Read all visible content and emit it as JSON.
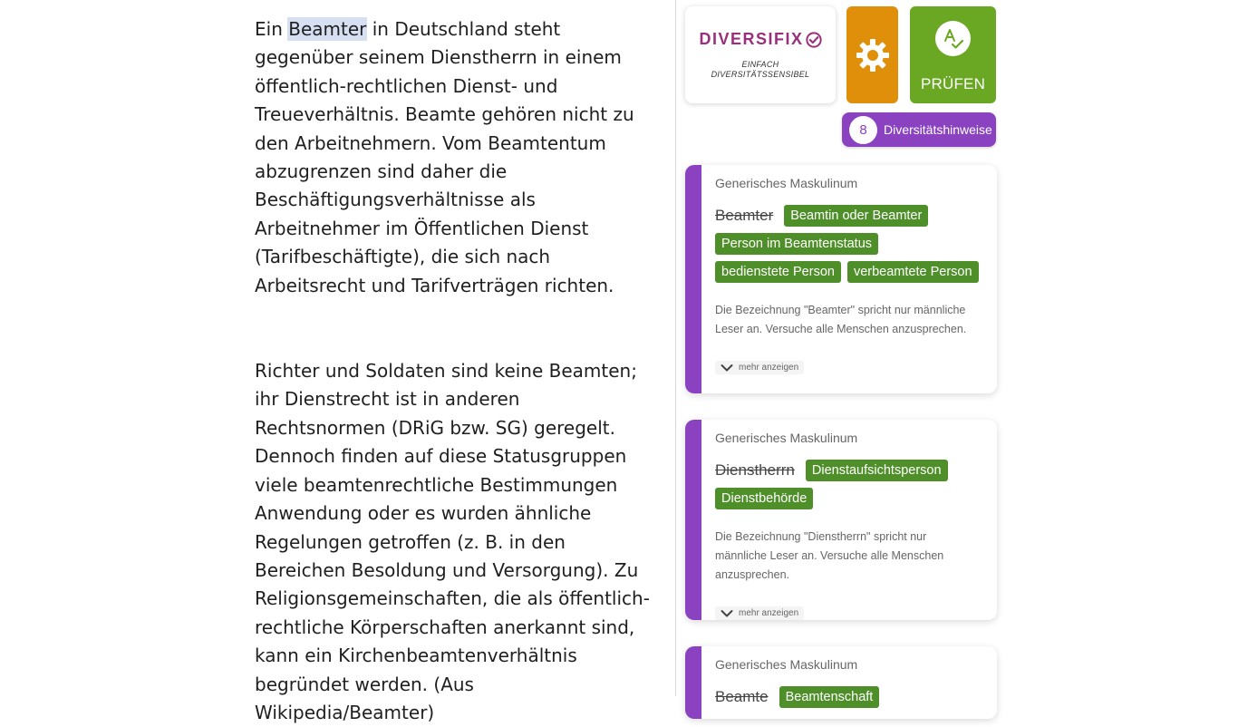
{
  "document": {
    "paragraph1": {
      "before": "Ein ",
      "highlight": "Beamter",
      "after": " in Deutschland steht gegenüber seinem Dienstherrn in einem öffentlich-rechtlichen Dienst- und Treueverhältnis. Beamte gehören nicht zu den Arbeitnehmern. Vom Beamtentum abzugrenzen sind daher die Beschäftigungsverhältnisse als Arbeitnehmer im Öffentlichen Dienst (Tarifbeschäftigte), die sich nach Arbeitsrecht und Tarifverträgen richten."
    },
    "paragraph2": "Richter und Soldaten sind keine Beamten; ihr Dienstrecht ist in anderen Rechtsnormen (DRiG bzw. SG) geregelt. Dennoch finden auf diese Statusgruppen viele beamtenrechtliche Bestimmungen Anwendung oder es wurden ähnliche Regelungen getroffen (z. B. in den Bereichen Besoldung und Versorgung). Zu Religionsgemeinschaften, die als öffentlich-rechtliche Körperschaften anerkannt sind, kann ein Kirchenbeamtenverhältnis begründet werden. (Aus Wikipedia/Beamter)"
  },
  "sidebar": {
    "logo": {
      "name": "DIVERSIFIX",
      "tagline_line1": "EINFACH",
      "tagline_line2": "DIVERSITÄTSSENSIBEL"
    },
    "settings_icon": "gear-icon",
    "check_button": {
      "label": "PRÜFEN",
      "icon": "spellcheck-icon"
    },
    "hints": {
      "count": "8",
      "label": "Diversitätshinweise"
    },
    "colors": {
      "accent": "#8a42c1",
      "settings": "#e08f0a",
      "check": "#6aa824",
      "suggestion": "#4f8f2a",
      "brand": "#9a2f7c"
    },
    "cards": [
      {
        "category": "Generisches Maskulinum",
        "original": "Beamter",
        "suggestions": [
          "Beamtin oder Beamter",
          "Person im Beamtenstatus",
          "bedienstete Person",
          "verbeamtete Person"
        ],
        "description": "Die Bezeichnung \"Beamter\" spricht nur männliche Leser an. Versuche alle Menschen anzusprechen.",
        "more": "mehr anzeigen"
      },
      {
        "category": "Generisches Maskulinum",
        "original": "Dienstherrn",
        "suggestions": [
          "Dienstaufsichtsperson",
          "Dienstbehörde"
        ],
        "description": "Die Bezeichnung \"Dienstherrn\" spricht nur männliche Leser an. Versuche alle Menschen anzusprechen.",
        "more": "mehr anzeigen"
      },
      {
        "category": "Generisches Maskulinum",
        "original": "Beamte",
        "suggestions": [
          "Beamtenschaft"
        ]
      }
    ]
  }
}
